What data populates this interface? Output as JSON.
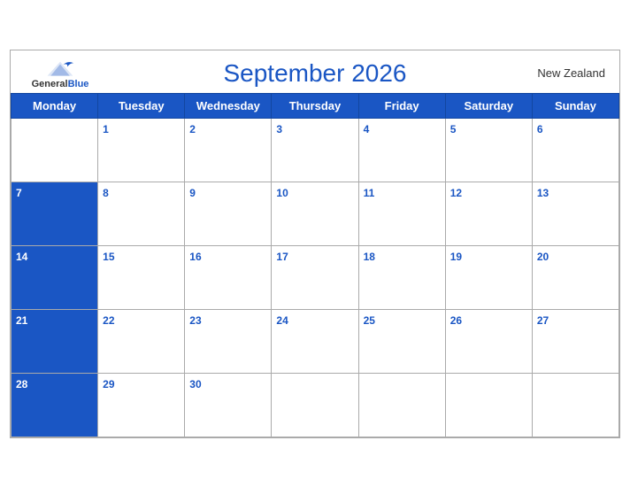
{
  "header": {
    "logo": {
      "general": "General",
      "blue": "Blue",
      "alt": "GeneralBlue logo"
    },
    "title": "September 2026",
    "country": "New Zealand"
  },
  "weekdays": [
    "Monday",
    "Tuesday",
    "Wednesday",
    "Thursday",
    "Friday",
    "Saturday",
    "Sunday"
  ],
  "weeks": [
    [
      null,
      1,
      2,
      3,
      4,
      5,
      6
    ],
    [
      7,
      8,
      9,
      10,
      11,
      12,
      13
    ],
    [
      14,
      15,
      16,
      17,
      18,
      19,
      20
    ],
    [
      21,
      22,
      23,
      24,
      25,
      26,
      27
    ],
    [
      28,
      29,
      30,
      null,
      null,
      null,
      null
    ]
  ],
  "colors": {
    "header_bg": "#1a56c4",
    "week_start_bg": "#1a56c4",
    "text_white": "#ffffff",
    "text_blue": "#1a56c4"
  }
}
